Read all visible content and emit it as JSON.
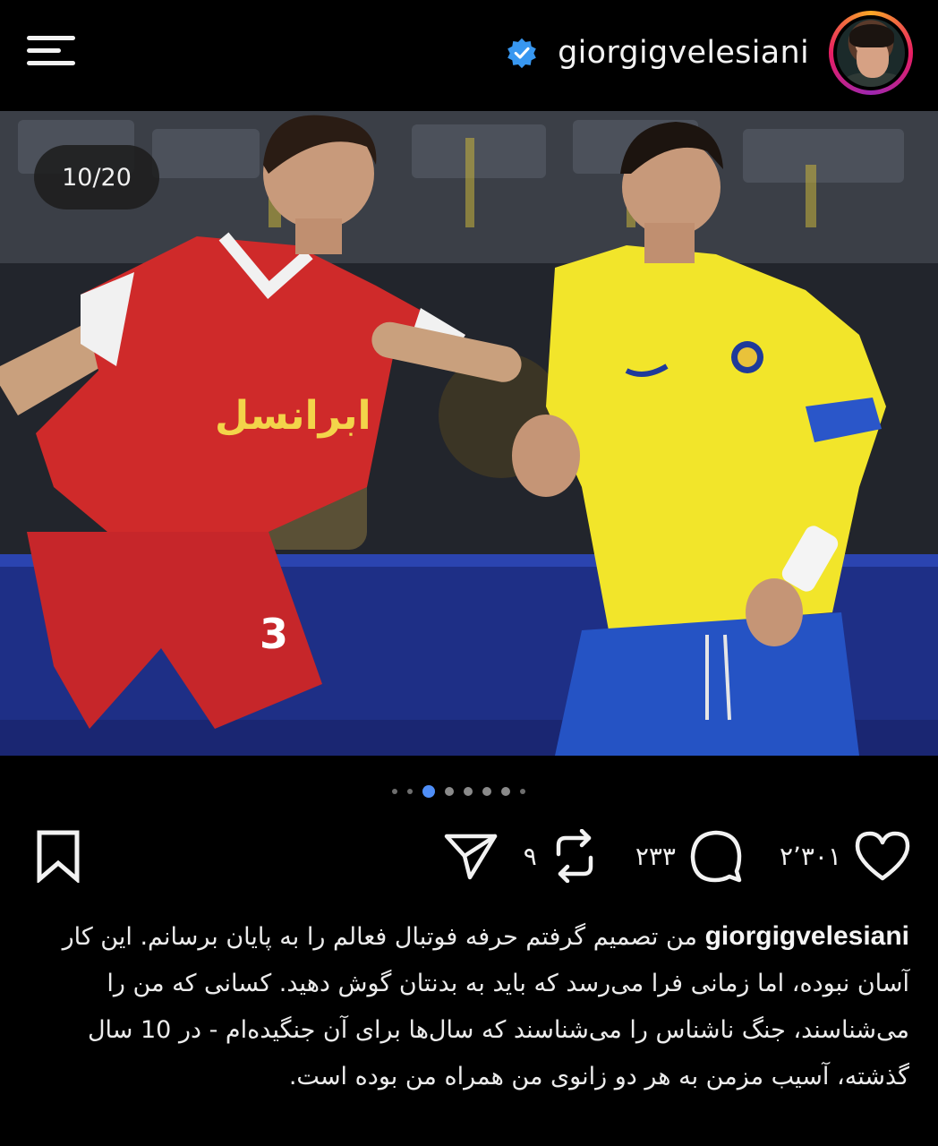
{
  "header": {
    "username": "giorgigvelesiani",
    "menu_icon": "hamburger-menu-icon",
    "verified_icon": "verified-badge-icon",
    "accent_color": "#3897f0"
  },
  "post": {
    "carousel_counter": "10/20",
    "carousel_dots": 8,
    "active_dot": 2
  },
  "actions": {
    "likes": "۲٬۳۰۱",
    "comments": "۲۳۳",
    "reposts": "۹",
    "like_icon": "heart-icon",
    "comment_icon": "comment-bubble-icon",
    "repost_icon": "repost-icon",
    "share_icon": "send-icon",
    "save_icon": "bookmark-icon"
  },
  "caption": {
    "author": "giorgigvelesiani",
    "text": "من تصمیم گرفتم حرفه فوتبال فعالم را به پایان برسانم. این کار آسان نبوده، اما زمانی فرا می‌رسد که باید به بدنتان گوش دهید. کسانی که من را می‌شناسند، جنگ ناشناس را می‌شناسند که سال‌ها برای آن جنگیده‌ام - در 10 سال گذشته، آسیب مزمن به هر دو زانوی من همراه من بوده است."
  }
}
